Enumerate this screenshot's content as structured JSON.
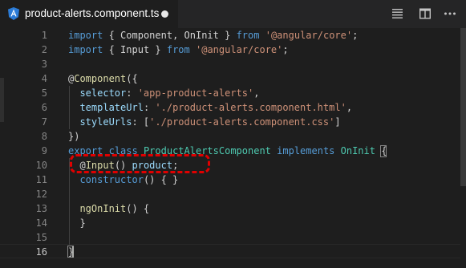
{
  "tab": {
    "icon": "angular-icon",
    "filename": "product-alerts.component.ts",
    "dirty": true
  },
  "toolbar": {
    "icons": [
      "open-changes-icon",
      "split-editor-icon",
      "more-actions-icon"
    ]
  },
  "colors": {
    "background": "#1e1e1e",
    "tab_bar": "#252526",
    "keyword": "#569cd6",
    "string": "#ce9178",
    "property": "#9cdcfe",
    "function": "#dcdcaa",
    "class": "#4ec9b0",
    "highlight_border": "#e00000"
  },
  "editor": {
    "active_line": 16,
    "highlighted_line": 10,
    "lines": [
      {
        "n": "1",
        "tokens": [
          [
            "kw",
            "import"
          ],
          [
            "punc",
            " { "
          ],
          [
            "punc",
            "Component"
          ],
          [
            "punc",
            ", "
          ],
          [
            "punc",
            "OnInit"
          ],
          [
            "punc",
            " } "
          ],
          [
            "kw",
            "from"
          ],
          [
            "punc",
            " "
          ],
          [
            "str",
            "'@angular/core'"
          ],
          [
            "punc",
            ";"
          ]
        ]
      },
      {
        "n": "2",
        "tokens": [
          [
            "kw",
            "import"
          ],
          [
            "punc",
            " { "
          ],
          [
            "punc",
            "Input"
          ],
          [
            "punc",
            " } "
          ],
          [
            "kw",
            "from"
          ],
          [
            "punc",
            " "
          ],
          [
            "str",
            "'@angular/core'"
          ],
          [
            "punc",
            ";"
          ]
        ]
      },
      {
        "n": "3",
        "tokens": []
      },
      {
        "n": "4",
        "tokens": [
          [
            "punc",
            "@"
          ],
          [
            "fn",
            "Component"
          ],
          [
            "punc",
            "({"
          ]
        ]
      },
      {
        "n": "5",
        "tokens": [
          [
            "punc",
            "  "
          ],
          [
            "prop",
            "selector"
          ],
          [
            "punc",
            ": "
          ],
          [
            "str",
            "'app-product-alerts'"
          ],
          [
            "punc",
            ","
          ]
        ]
      },
      {
        "n": "6",
        "tokens": [
          [
            "punc",
            "  "
          ],
          [
            "prop",
            "templateUrl"
          ],
          [
            "punc",
            ": "
          ],
          [
            "str",
            "'./product-alerts.component.html'"
          ],
          [
            "punc",
            ","
          ]
        ]
      },
      {
        "n": "7",
        "tokens": [
          [
            "punc",
            "  "
          ],
          [
            "prop",
            "styleUrls"
          ],
          [
            "punc",
            ": ["
          ],
          [
            "str",
            "'./product-alerts.component.css'"
          ],
          [
            "punc",
            "]"
          ]
        ]
      },
      {
        "n": "8",
        "tokens": [
          [
            "punc",
            "})"
          ]
        ]
      },
      {
        "n": "9",
        "tokens": [
          [
            "kw",
            "export"
          ],
          [
            "punc",
            " "
          ],
          [
            "kw",
            "class"
          ],
          [
            "punc",
            " "
          ],
          [
            "cls",
            "ProductAlertsComponent"
          ],
          [
            "punc",
            " "
          ],
          [
            "kw",
            "implements"
          ],
          [
            "punc",
            " "
          ],
          [
            "cls",
            "OnInit"
          ],
          [
            "punc",
            " {"
          ]
        ]
      },
      {
        "n": "10",
        "tokens": [
          [
            "punc",
            "  @"
          ],
          [
            "fn",
            "Input"
          ],
          [
            "punc",
            "() "
          ],
          [
            "prop",
            "product"
          ],
          [
            "punc",
            ";"
          ]
        ]
      },
      {
        "n": "11",
        "tokens": [
          [
            "punc",
            "  "
          ],
          [
            "kw",
            "constructor"
          ],
          [
            "punc",
            "() { }"
          ]
        ]
      },
      {
        "n": "12",
        "tokens": []
      },
      {
        "n": "13",
        "tokens": [
          [
            "punc",
            "  "
          ],
          [
            "fn",
            "ngOnInit"
          ],
          [
            "punc",
            "() {"
          ]
        ]
      },
      {
        "n": "14",
        "tokens": [
          [
            "punc",
            "  }"
          ]
        ]
      },
      {
        "n": "15",
        "tokens": []
      },
      {
        "n": "16",
        "tokens": [
          [
            "punc",
            "}"
          ]
        ]
      }
    ]
  }
}
